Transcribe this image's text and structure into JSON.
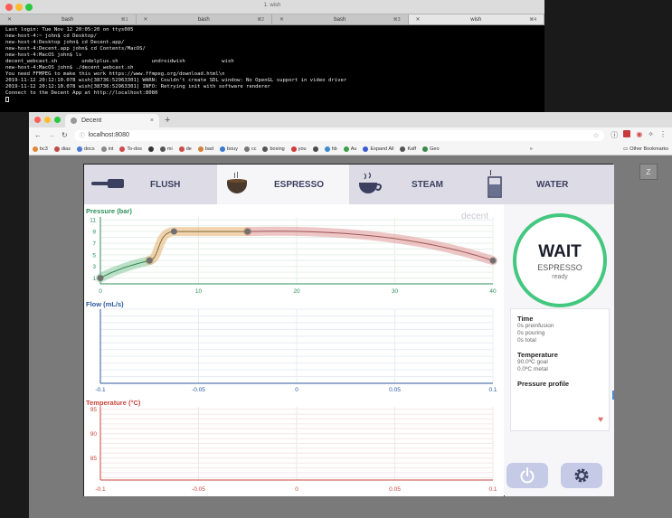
{
  "terminal": {
    "title": "1. wish",
    "tabs": [
      {
        "label": "bash",
        "shortcut": "⌘1",
        "active": false
      },
      {
        "label": "bash",
        "shortcut": "⌘2",
        "active": false
      },
      {
        "label": "bash",
        "shortcut": "⌘3",
        "active": false
      },
      {
        "label": "wish",
        "shortcut": "⌘4",
        "active": true
      }
    ],
    "lines": [
      "Last login: Tue Nov 12 20:05:20 on ttys005",
      "new-host-4:~ john$ cd Desktop/",
      "new-host-4:Desktop john$ cd Decent.app/",
      "new-host-4:Decent.app john$ cd Contents/MacOS/",
      "new-host-4:MacOS john$ ls",
      "decent_webcast.sh        undelplus.sh           undroidwish            wish",
      "new-host-4:MacOS john$ ./decent_webcast.sh",
      "You need FFMPEG to make this work https://www.ffmpeg.org/download.html\\n",
      "2019-11-12 20:12:10.078 wish[38736:52963301] WARN: Couldn't create SDL window: No OpenGL support in video driver",
      "2019-11-12 20:12:10.078 wish[38736:52963301] INFO: Retrying init with software renderer",
      "Connect to the Decent App at http://localhost:8080"
    ]
  },
  "browser": {
    "tab_title": "Decent",
    "tab_close": "×",
    "new_tab": "+",
    "url": "localhost:8080",
    "nav": {
      "back": "←",
      "forward": "→",
      "reload": "↻"
    },
    "bookmarks": [
      {
        "label": "bc3",
        "color": "#e0873a"
      },
      {
        "label": "dias",
        "color": "#c24a4a"
      },
      {
        "label": "docs",
        "color": "#4a7ad1"
      },
      {
        "label": "int",
        "color": "#8a8a8a"
      },
      {
        "label": "To-dos",
        "color": "#d14a4a"
      },
      {
        "label": "",
        "color": "#333333"
      },
      {
        "label": "mi",
        "color": "#555555"
      },
      {
        "label": "de",
        "color": "#c94a4a"
      },
      {
        "label": "bad",
        "color": "#d1813a"
      },
      {
        "label": "bouy",
        "color": "#3a7ad1"
      },
      {
        "label": "cc",
        "color": "#777777"
      },
      {
        "label": "boxing",
        "color": "#555555"
      },
      {
        "label": "you",
        "color": "#d13a3a"
      },
      {
        "label": "",
        "color": "#4a4a4a"
      },
      {
        "label": "hb",
        "color": "#3a8ad1"
      },
      {
        "label": "Au",
        "color": "#3aa14a"
      },
      {
        "label": "Expand All",
        "color": "#3a5ad1"
      },
      {
        "label": "Kaff",
        "color": "#555555"
      },
      {
        "label": "Geo",
        "color": "#3a8a4a"
      }
    ],
    "more_bookmarks": "»",
    "other_bookmarks": "Other Bookmarks"
  },
  "z_button": "Z",
  "app": {
    "tabs": [
      {
        "label": "FLUSH",
        "active": false
      },
      {
        "label": "ESPRESSO",
        "active": true
      },
      {
        "label": "STEAM",
        "active": false
      },
      {
        "label": "WATER",
        "active": false
      }
    ],
    "logo": "decent",
    "status": {
      "main": "WAIT",
      "sub": "ESPRESSO",
      "state": "ready"
    },
    "info": {
      "time_heading": "Time",
      "time_lines": [
        "0s preinfusion",
        "0s pouring",
        "0s total"
      ],
      "temp_heading": "Temperature",
      "temp_lines": [
        "90.0ºC  goal",
        "0.0ºC    metal"
      ],
      "profile_heading": "Pressure profile"
    }
  },
  "colors": {
    "pressure": "#2c8f5a",
    "flow": "#2b5aa0",
    "temperature": "#c8453d",
    "ring": "#44c77f",
    "profile_start": "#6dbd85",
    "profile_mid": "#e3b070",
    "profile_end": "#dd8e8e"
  },
  "chart_data": [
    {
      "type": "line",
      "title": "Pressure (bar)",
      "x_ticks": [
        0,
        10,
        20,
        30,
        40
      ],
      "y_ticks": [
        1,
        3,
        5,
        7,
        9,
        11
      ],
      "xlim": [
        0,
        40
      ],
      "ylim": [
        0,
        11.5
      ],
      "series": [
        {
          "name": "",
          "points": [
            [
              0,
              1
            ],
            [
              5,
              4
            ],
            [
              7.5,
              9
            ],
            [
              15,
              9
            ],
            [
              40,
              4
            ]
          ]
        }
      ]
    },
    {
      "type": "line",
      "title": "Flow (mL/s)",
      "x_ticks": [
        -0.1,
        -0.05,
        0,
        0.05,
        0.1
      ],
      "xlim": [
        -0.1,
        0.1
      ],
      "series": []
    },
    {
      "type": "line",
      "title": "Temperature (°C)",
      "x_ticks": [
        -0.1,
        -0.05,
        0,
        0.05,
        0.1
      ],
      "y_ticks": [
        85,
        90,
        95
      ],
      "xlim": [
        -0.1,
        0.1
      ],
      "ylim": [
        80.5,
        95.5
      ],
      "series": []
    }
  ]
}
